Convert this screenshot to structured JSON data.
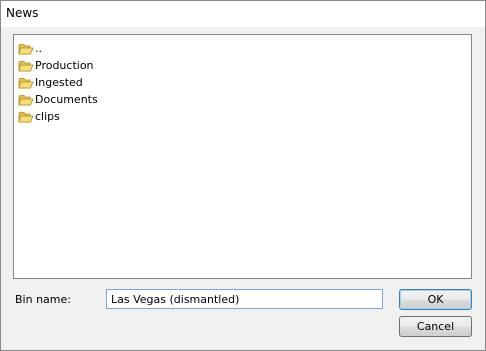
{
  "window": {
    "title": "News"
  },
  "list": {
    "icon": "folder-icon",
    "items": [
      {
        "label": ".."
      },
      {
        "label": "Production"
      },
      {
        "label": "Ingested"
      },
      {
        "label": "Documents"
      },
      {
        "label": "clips"
      }
    ]
  },
  "form": {
    "bin_name_label": "Bin name:",
    "bin_name_value": "Las Vegas (dismantled)"
  },
  "buttons": {
    "ok_label": "OK",
    "cancel_label": "Cancel"
  }
}
